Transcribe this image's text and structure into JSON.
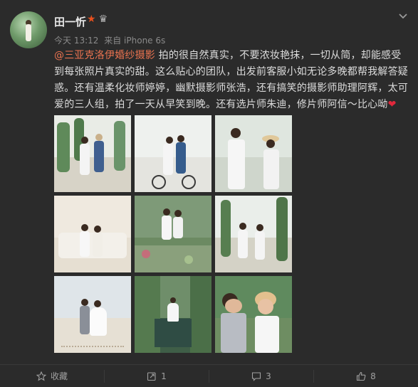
{
  "user": {
    "name": "田一忻",
    "badges": {
      "vip_star": "★",
      "crown": "♛"
    }
  },
  "post": {
    "time": "今天 13:12",
    "source": "来自 iPhone 6s",
    "mention": "@三亚克洛伊婚纱摄影",
    "text": " 拍的很自然真实，不要浓妆艳抹，一切从简，却能感受到每张照片真实的甜。这么贴心的团队，出发前客服小如无论多晚都帮我解答疑惑。还有温柔化妆师婷婷，幽默摄影师张浩，还有搞笑的摄影师助理阿辉，太可爱的三人组，拍了一天从早笑到晚。还有选片师朱迪，修片师阿信～比心呦",
    "heart": "❤"
  },
  "footer": {
    "favorite_label": "收藏",
    "repost_count": "1",
    "comment_count": "3",
    "like_count": "8"
  },
  "colors": {
    "mention": "#eb7350",
    "background": "#2b2b2b"
  }
}
